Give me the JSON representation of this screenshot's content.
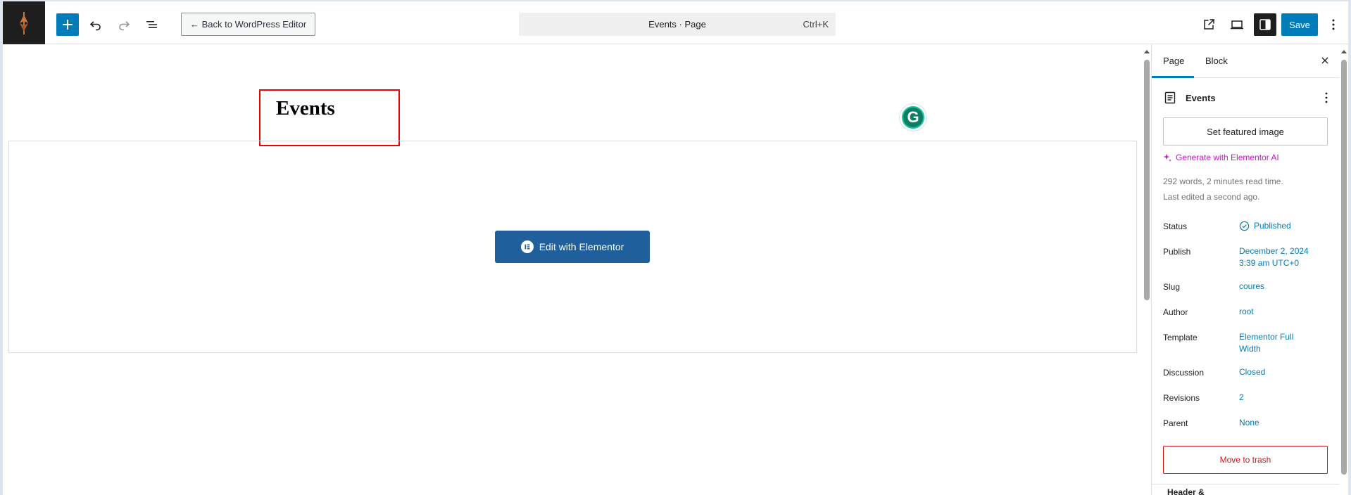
{
  "topbar": {
    "back_label": "← Back to WordPress Editor",
    "command_title": "Events · Page",
    "command_shortcut": "Ctrl+K",
    "save_label": "Save"
  },
  "canvas": {
    "page_title": "Events",
    "grammarly_letter": "G",
    "elementor_button_label": "Edit with Elementor"
  },
  "sidebar": {
    "tabs": [
      "Page",
      "Block"
    ],
    "post_name": "Events",
    "featured_image_label": "Set featured image",
    "ai_link_label": "Generate with Elementor AI",
    "stats_text": "292 words, 2 minutes read time.",
    "last_edited_text": "Last edited a second ago.",
    "rows": {
      "status": {
        "label": "Status",
        "value": "Published"
      },
      "publish": {
        "label": "Publish",
        "value_line1": "December 2, 2024",
        "value_line2": "3:39 am UTC+0"
      },
      "slug": {
        "label": "Slug",
        "value": "coures"
      },
      "author": {
        "label": "Author",
        "value": "root"
      },
      "template": {
        "label": "Template",
        "value_line1": "Elementor Full",
        "value_line2": "Width"
      },
      "discussion": {
        "label": "Discussion",
        "value": "Closed"
      },
      "revisions": {
        "label": "Revisions",
        "value": "2"
      },
      "parent": {
        "label": "Parent",
        "value": "None"
      }
    },
    "trash_label": "Move to trash",
    "next_section_label": "Header &"
  },
  "colors": {
    "accent": "#007cba",
    "elementor_button": "#1f5f9b",
    "destructive": "#cc1818",
    "ai_link": "#c418c4",
    "title_highlight": "#ee0000"
  },
  "icons": [
    "site-logo-icon",
    "plus-icon",
    "undo-icon",
    "redo-icon",
    "list-view-icon",
    "external-link-icon",
    "preview-device-icon",
    "settings-sidebar-icon",
    "more-options-icon",
    "close-icon",
    "document-icon",
    "sparkle-icon",
    "published-check-icon",
    "elementor-logo-icon",
    "grammarly-icon"
  ]
}
